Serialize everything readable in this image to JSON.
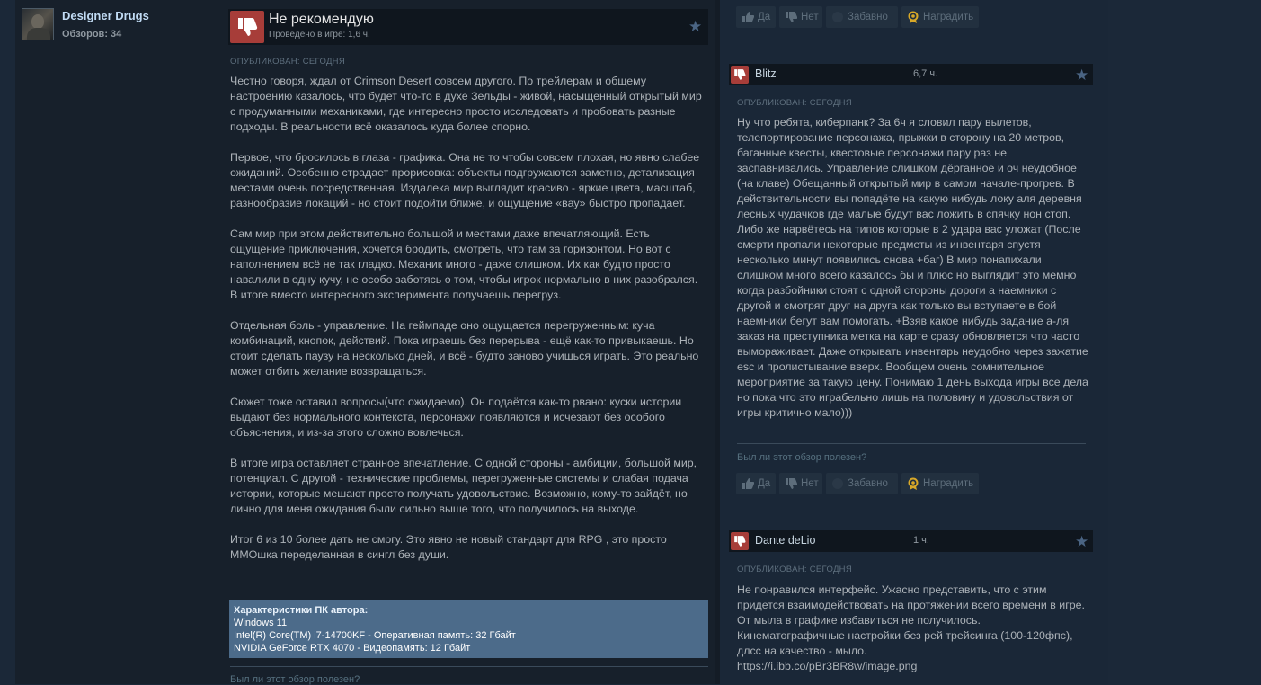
{
  "author": {
    "name": "Designer Drugs",
    "reviews_count": "Обзоров: 34"
  },
  "main_review": {
    "title": "Не рекомендую",
    "hours": "Проведено в игре: 1,6 ч.",
    "posted": "ОПУБЛИКОВАН: СЕГОДНЯ",
    "paragraphs": [
      "Честно говоря, ждал от Crimson Desert совсем другого. По трейлерам и общему настроению казалось, что будет что-то в духе Зельды - живой, насыщенный открытый мир с продуманными механиками, где интересно просто исследовать и пробовать разные подходы. В реальности всё оказалось куда более спорно.",
      "Первое, что бросилось в глаза - графика. Она не то чтобы совсем плохая, но явно слабее ожиданий. Особенно страдает прорисовка: объекты подгружаются заметно, детализация местами очень посредственная. Издалека мир выглядит красиво - яркие цвета, масштаб, разнообразие локаций - но стоит подойти ближе, и ощущение «вау» быстро пропадает.",
      "Сам мир при этом действительно большой и местами даже впечатляющий. Есть ощущение приключения, хочется бродить, смотреть, что там за горизонтом. Но вот с наполнением всё не так гладко. Механик много - даже слишком. Их как будто просто навалили в одну кучу, не особо заботясь о том, чтобы игрок нормально в них разобрался. В итоге вместо интересного эксперимента получаешь перегруз.",
      "Отдельная боль - управление. На геймпаде оно ощущается перегруженным: куча комбинаций, кнопок, действий. Пока играешь без перерыва - ещё как-то привыкаешь. Но стоит сделать паузу на несколько дней, и всё - будто заново учишься играть. Это реально может отбить желание возвращаться.",
      "Сюжет тоже оставил вопросы(что ожидаемо). Он подаётся как-то рвано: куски истории выдают без нормального контекста, персонажи появляются и исчезают без особого объяснения, и из-за этого сложно вовлечься.",
      "В итоге игра оставляет странное впечатление. С одной стороны - амбиции, большой мир, потенциал. С другой - технические проблемы, перегруженные системы и слабая подача истории, которые мешают просто получать удовольствие. Возможно, кому-то зайдёт, но лично для меня ожидания были сильно выше того, что получилось на выходе.",
      "Итог 6 из 10 более дать не смогу. Это явно не новый стандарт для RPG , это просто ММОшка переделанная в сингл без души."
    ],
    "specs": {
      "title": "Характеристики ПК автора:",
      "os": "Windows 11",
      "cpu": "Intel(R) Core(TM) i7-14700KF - Оперативная память: 32 Гбайт",
      "gpu": "NVIDIA GeForce RTX 4070 - Видеопамять: 12 Гбайт"
    },
    "helpful_question": "Был ли этот обзор полезен?"
  },
  "vote_labels": {
    "yes": "Да",
    "no": "Нет",
    "funny": "Забавно",
    "award": "Наградить"
  },
  "side_reviews": [
    {
      "name": "Blitz",
      "hours": "6,7 ч.",
      "posted": "ОПУБЛИКОВАН: СЕГОДНЯ",
      "text": "Ну что ребята, киберпанк? За 6ч я словил пару вылетов, телепортирование персонажа, прыжки в сторону на 20 метров, баганные квесты, квестовые персонажи пару раз не заспавнивались. Управление слишком дёрганное и оч неудобное (на клаве) Обещанный открытый мир в самом начале-прогрев. В действительности вы попадёте на какую нибудь локу аля деревня лесных чудачков где малые будут вас ложить в спячку нон стоп. Либо же нарвётесь на типов которые в 2 удара вас уложат (После смерти пропали некоторые предметы из инвентаря спустя несколько минут появились снова +баг) В мир понапихали слишком много всего казалось бы и плюс но выглядит это мемно когда разбойники стоят с одной стороны дороги а наемники с другой и смотрят друг на друга как только вы вступаете в бой наемники бегут вам помогать. +Взяв какое нибудь задание а-ля заказ на преступника метка на карте сразу обновляется что часто вымораживает. Даже открывать инвентарь неудобно через зажатие esc и пролистывание вверх. Вообщем очень сомнительное мероприятие за такую цену. Понимаю 1 день выхода игры все дела но пока что это играбельно лишь на половину и удовольствия от игры критично мало)))",
      "helpful_question": "Был ли этот обзор полезен?"
    },
    {
      "name": "Dante deLio",
      "hours": "1 ч.",
      "posted": "ОПУБЛИКОВАН: СЕГОДНЯ",
      "lines": [
        "Не понравился интерфейс. Ужасно представить, что с этим придется взаимодействовать на протяжении всего времени в игре.",
        "От мыла в графике избавиться не получилось.",
        "Кинематографичные настройки без рей трейсинга (100-120фпс), длсс на качество - мыло.",
        "https://i.ibb.co/pBr3BR8w/image.png"
      ]
    }
  ]
}
